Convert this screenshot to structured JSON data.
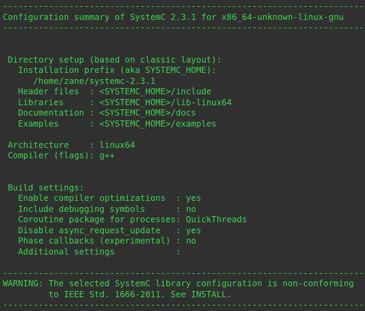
{
  "theme": {
    "background": "#303030",
    "text_color": "#3fd44f"
  },
  "rule": "---------------------------------------------------------------------------------------------",
  "header_title": "Configuration summary of SystemC 2.3.1 for x86_64-unknown-linux-gnu",
  "directory": {
    "heading": " Directory setup (based on classic layout):",
    "install_label": "   Installation prefix (aka SYSTEMC_HOME):",
    "install_value": "      /home/zane/systemc-2.3.1",
    "rows": [
      "   Header files  : <SYSTEMC_HOME>/include",
      "   Libraries     : <SYSTEMC_HOME>/lib-linux64",
      "   Documentation : <SYSTEMC_HOME>/docs",
      "   Examples      : <SYSTEMC_HOME>/examples"
    ]
  },
  "system": {
    "architecture": " Architecture    : linux64",
    "compiler": " Compiler (flags): g++"
  },
  "build": {
    "heading": " Build settings:",
    "rows": [
      "   Enable compiler optimizations  : yes",
      "   Include debugging symbols      : no",
      "   Coroutine package for processes: QuickThreads",
      "   Disable async_request_update   : yes",
      "   Phase callbacks (experimental) : no",
      "   Additional settings            :"
    ]
  },
  "warning": {
    "line1": "WARNING: The selected SystemC library configuration is non-conforming",
    "line2": "         to IEEE Std. 1666-2011. See INSTALL."
  }
}
